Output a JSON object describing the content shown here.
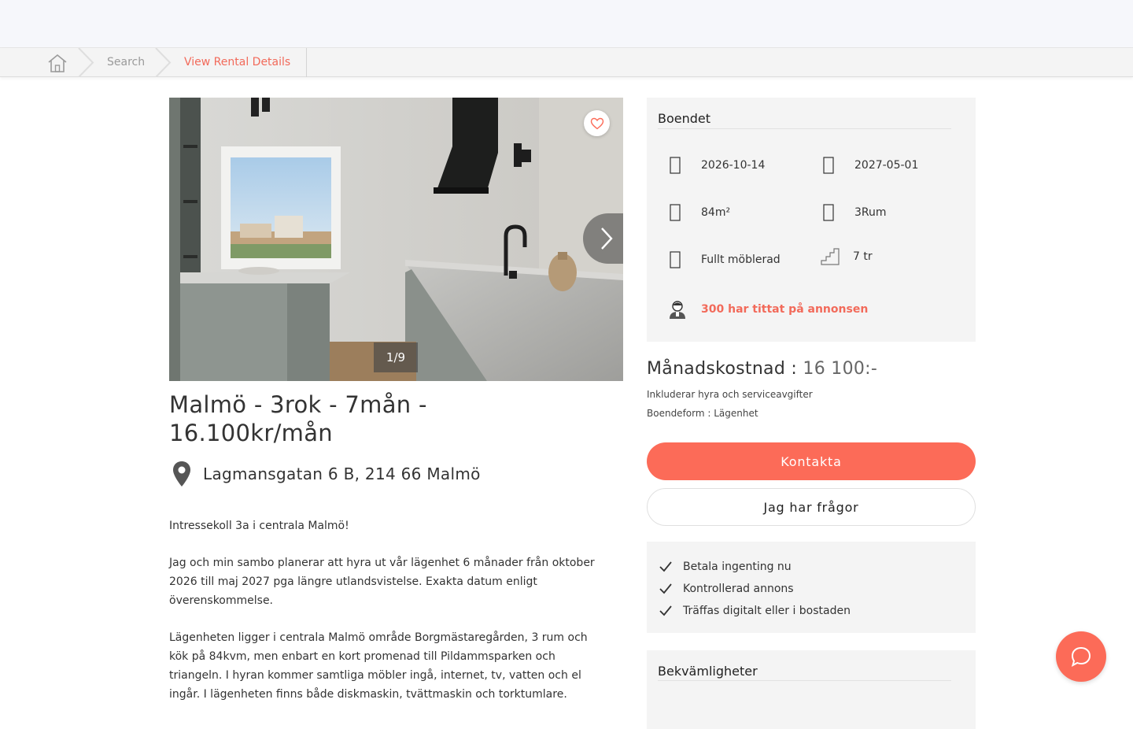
{
  "breadcrumb": {
    "home_icon": "home-icon",
    "search_label": "Search",
    "current_label": "View Rental Details"
  },
  "gallery": {
    "counter": "1/9",
    "favorite_icon": "heart-icon",
    "next_icon": "chevron-right-icon"
  },
  "listing": {
    "title": "Malmö - 3rok - 7mån - 16.100kr/mån",
    "address": "Lagmansgatan 6 B, 214 66 Malmö",
    "description": [
      "Intressekoll 3a i centrala Malmö!",
      "Jag och min sambo planerar att hyra ut vår lägenhet 6 månader från oktober 2026 till maj 2027 pga längre utlandsvistelse. Exakta datum enligt överenskommelse.",
      "Lägenheten ligger i centrala Malmö område Borgmästaregården, 3 rum och kök på 84kvm, men enbart en kort promenad till Pildammsparken och triangeln. I hyran kommer samtliga möbler ingå, internet, tv, vatten och el ingår. I lägenheten finns både diskmaskin, tvättmaskin och torktumlare."
    ]
  },
  "housing": {
    "title": "Boendet",
    "move_in": "2026-10-14",
    "move_out": "2027-05-01",
    "size": "84m²",
    "rooms": "3Rum",
    "furnishing": "Fullt möblerad",
    "floor": "7 tr",
    "views": "300 har tittat på annonsen"
  },
  "cost": {
    "label": "Månadskostnad : ",
    "amount": "16 100:-",
    "note": "Inkluderar hyra och serviceavgifter",
    "housing_type": "Boendeform : Lägenhet"
  },
  "actions": {
    "contact": "Kontakta",
    "questions": "Jag har frågor"
  },
  "perks": [
    "Betala ingenting nu",
    "Kontrollerad annons",
    "Träffas digitalt eller i bostaden"
  ],
  "amenities": {
    "title": "Bekvämligheter"
  },
  "colors": {
    "accent": "#fc6b58",
    "accent_text": "#f26a5a",
    "card_bg": "#f4f4f4"
  }
}
